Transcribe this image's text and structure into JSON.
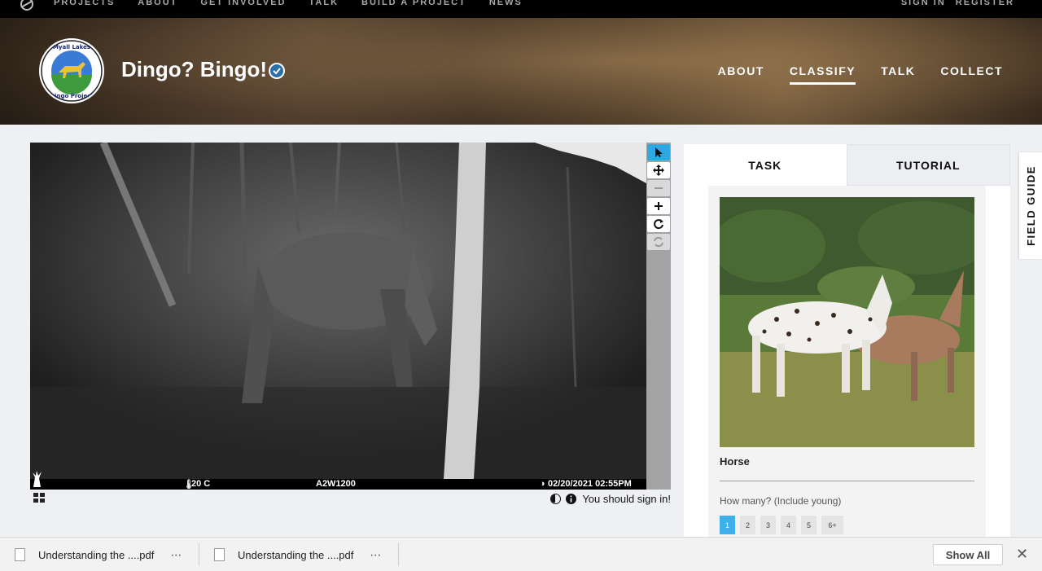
{
  "topnav": {
    "links": [
      "PROJECTS",
      "ABOUT",
      "GET INVOLVED",
      "TALK",
      "BUILD A PROJECT",
      "NEWS"
    ],
    "sign_in": "SIGN IN",
    "register": "REGISTER"
  },
  "project": {
    "title": "Dingo? Bingo!",
    "avatar_text_top": "Myall Lakes",
    "avatar_text_bottom": "Dingo Project",
    "nav": [
      "ABOUT",
      "CLASSIFY",
      "TALK",
      "COLLECT"
    ],
    "active_nav": "CLASSIFY"
  },
  "viewer": {
    "temperature": "20 C",
    "camera_id": "A2W1200",
    "timestamp": "02/20/2021 02:55PM",
    "sign_in_prompt": "You should sign in!"
  },
  "task_panel": {
    "tab_task": "TASK",
    "tab_tutorial": "TUTORIAL",
    "choice_label": "Horse",
    "question": "How many? (Include young)",
    "counts": [
      "1",
      "2",
      "3",
      "4",
      "5",
      "6+"
    ],
    "selected_count": "1"
  },
  "field_guide": "FIELD GUIDE",
  "downloads": {
    "items": [
      "Understanding the ....pdf",
      "Understanding the ....pdf"
    ],
    "show_all": "Show All"
  },
  "colors": {
    "accent": "#2ea8e0",
    "count_selected": "#3fb0ea"
  }
}
